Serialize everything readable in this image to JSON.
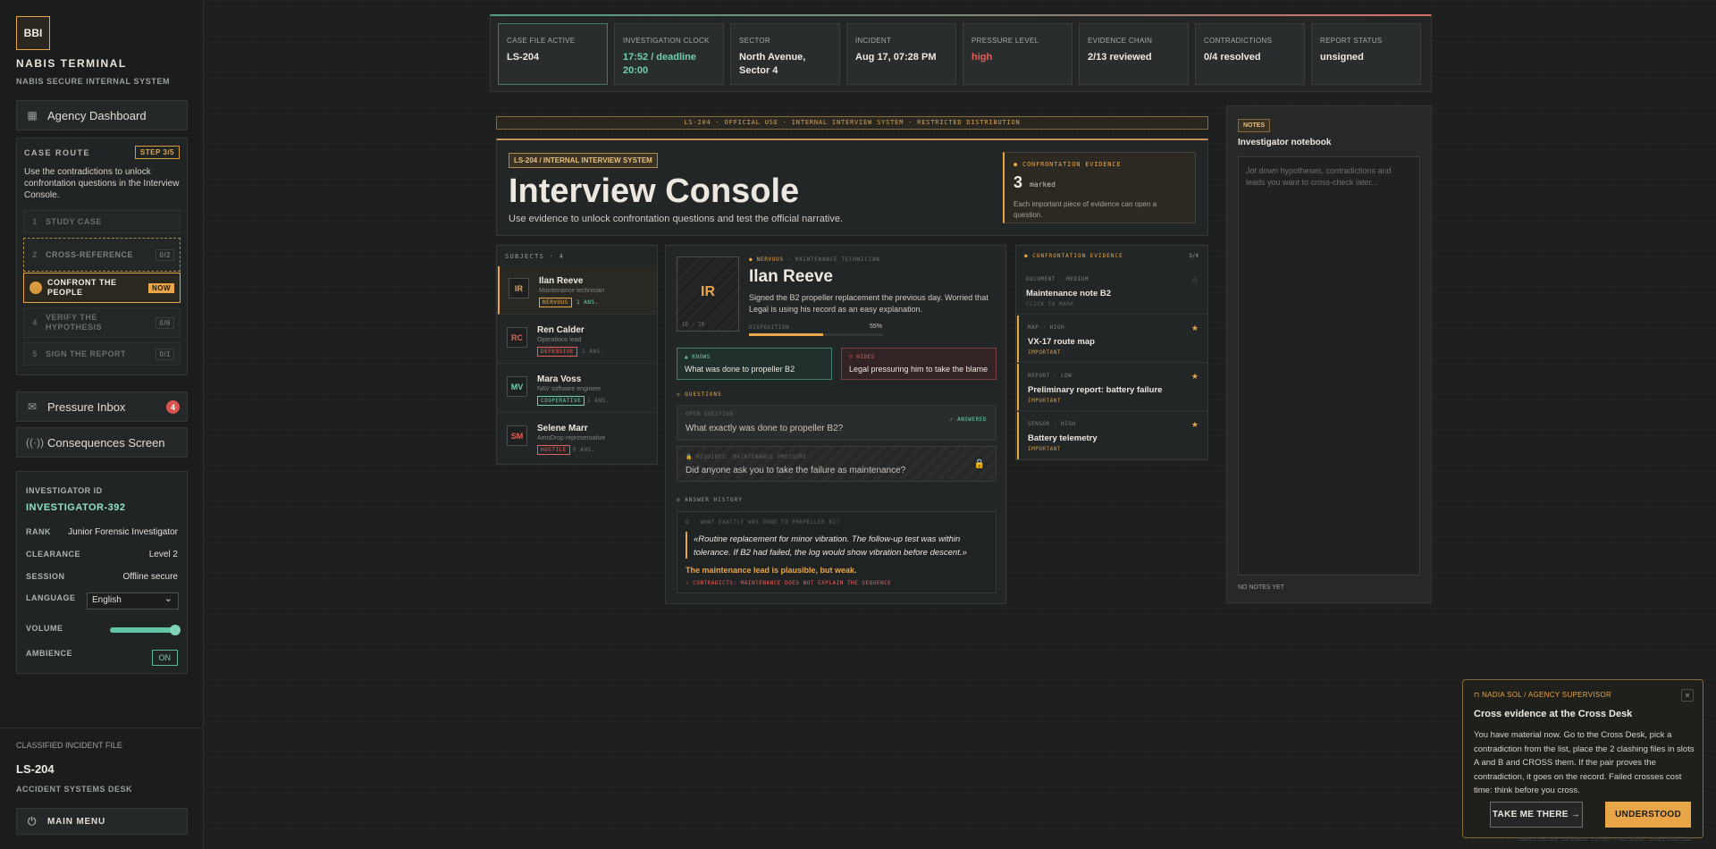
{
  "sidebar": {
    "logo": "BBI",
    "title": "NABIS TERMINAL",
    "subtitle": "NABIS SECURE INTERNAL SYSTEM",
    "nav": {
      "dashboard": "Agency Dashboard",
      "pressure_inbox": "Pressure Inbox",
      "pressure_badge": "4",
      "consequences": "Consequences Screen"
    },
    "route": {
      "heading": "CASE ROUTE",
      "step_tag": "STEP 3/5",
      "description": "Use the contradictions to unlock confrontation questions in the Interview Console.",
      "steps": [
        {
          "num": "1",
          "label": "STUDY CASE",
          "count": ""
        },
        {
          "num": "2",
          "label": "CROSS-REFERENCE",
          "count": "0/2"
        },
        {
          "num": "",
          "label": "CONFRONT THE PEOPLE",
          "count": "NOW"
        },
        {
          "num": "4",
          "label": "VERIFY THE HYPOTHESIS",
          "count": "0/6"
        },
        {
          "num": "5",
          "label": "SIGN THE REPORT",
          "count": "0/1"
        }
      ]
    },
    "investigator": {
      "id_label": "INVESTIGATOR ID",
      "id_value": "INVESTIGATOR-392",
      "rank_label": "RANK",
      "rank_value": "Junior Forensic Investigator",
      "clearance_label": "CLEARANCE",
      "clearance_value": "Level 2",
      "session_label": "SESSION",
      "session_value": "Offline secure",
      "language_label": "LANGUAGE",
      "language_value": "English",
      "volume_label": "VOLUME",
      "volume_level": 0.9,
      "ambience_label": "AMBIENCE",
      "ambience_value": "ON"
    },
    "footer": {
      "label": "CLASSIFIED INCIDENT FILE",
      "case": "LS-204",
      "desk": "ACCIDENT SYSTEMS DESK",
      "menu": "MAIN MENU"
    }
  },
  "topbar": [
    {
      "label": "CASE FILE ACTIVE",
      "value": "LS-204",
      "color": "#eee9e0"
    },
    {
      "label": "INVESTIGATION CLOCK",
      "value": "17:52 / deadline 20:00",
      "color": "#6fd0b0"
    },
    {
      "label": "SECTOR",
      "value": "North Avenue, Sector 4",
      "color": "#eee9e0"
    },
    {
      "label": "INCIDENT",
      "value": "Aug 17, 07:28 PM",
      "color": "#eee9e0"
    },
    {
      "label": "PRESSURE LEVEL",
      "value": "high",
      "color": "#e5605a"
    },
    {
      "label": "EVIDENCE CHAIN",
      "value": "2/13 reviewed",
      "color": "#eee9e0"
    },
    {
      "label": "CONTRADICTIONS",
      "value": "0/4 resolved",
      "color": "#eee9e0"
    },
    {
      "label": "REPORT STATUS",
      "value": "unsigned",
      "color": "#eee9e0"
    }
  ],
  "banner": "LS-204 · OFFICIAL USE · INTERNAL INTERVIEW SYSTEM · RESTRICTED DISTRIBUTION",
  "header": {
    "tag": "LS-204 / INTERNAL INTERVIEW SYSTEM",
    "title": "Interview Console",
    "subtitle": "Use evidence to unlock confrontation questions and test the official narrative.",
    "evidence_label": "CONFRONTATION EVIDENCE",
    "evidence_count": "3",
    "evidence_marked": "marked",
    "evidence_note": "Each important piece of evidence can open a question."
  },
  "subjects": {
    "heading": "SUBJECTS · 4",
    "items": [
      {
        "initials": "IR",
        "name": "Ilan Reeve",
        "role": "Maintenance technician",
        "tag": "NERVOUS",
        "ans": "1 ANS.",
        "color": "#e8a649",
        "ans_color": "#6fd0b0"
      },
      {
        "initials": "RC",
        "name": "Ren Calder",
        "role": "Operations lead",
        "tag": "DEFENSIVE",
        "ans": "1 ANS.",
        "color": "#e5605a",
        "ans_color": "#6d716e"
      },
      {
        "initials": "MV",
        "name": "Mara Voss",
        "role": "NAV software engineer",
        "tag": "COOPERATIVE",
        "ans": "1 ANS.",
        "color": "#6fd0b0",
        "ans_color": "#6d716e"
      },
      {
        "initials": "SM",
        "name": "Selene Marr",
        "role": "AeroDrop representative",
        "tag": "HOSTILE",
        "ans": "0 ANS.",
        "color": "#e5605a",
        "ans_color": "#6d716e"
      }
    ]
  },
  "profile": {
    "initials": "IR",
    "photo_code": "ID · IR",
    "status": "NERVOUS",
    "role": "MAINTENANCE TECHNICIAN",
    "name": "Ilan Reeve",
    "desc": "Signed the B2 propeller replacement the previous day. Worried that Legal is using his record as an easy explanation.",
    "disposition_label": "DISPOSITION",
    "disposition_value": "55%",
    "disposition_fraction": 0.55,
    "knows_label": "KNOWS",
    "knows_text": "What was done to propeller B2",
    "hides_label": "HIDES",
    "hides_text": "Legal pressuring him to take the blame",
    "questions_label": "QUESTIONS",
    "q1_cat": "OPEN QUESTION",
    "q1_status": "✓ ANSWERED",
    "q1_text": "What exactly was done to propeller B2?",
    "q2_cat": "REQUIRES: MAINTENANCE PRESSURE",
    "q2_text": "Did anyone ask you to take the failure as maintenance?",
    "history_label": "ANSWER HISTORY",
    "history_q": "Q · WHAT EXACTLY WAS DONE TO PROPELLER B2?",
    "history_answer": "«Routine replacement for minor vibration. The follow-up test was within tolerance. If B2 had failed, the log would show vibration before descent.»",
    "history_verdict": "The maintenance lead is plausible, but weak.",
    "history_contradicts": "⚠ CONTRADICTS: MAINTENANCE DOES NOT EXPLAIN THE SEQUENCE"
  },
  "evidence": {
    "heading": "CONFRONTATION EVIDENCE",
    "count": "3/4",
    "items": [
      {
        "cat": "DOCUMENT · MEDIUM",
        "title": "Maintenance note B2",
        "sub": "CLICK TO MARK",
        "marked": false
      },
      {
        "cat": "MAP · HIGH",
        "title": "VX-17 route map",
        "sub": "IMPORTANT",
        "marked": true
      },
      {
        "cat": "REPORT · LOW",
        "title": "Preliminary report: battery failure",
        "sub": "IMPORTANT",
        "marked": true
      },
      {
        "cat": "SENSOR · HIGH",
        "title": "Battery telemetry",
        "sub": "IMPORTANT",
        "marked": true
      }
    ]
  },
  "notes": {
    "tag": "NOTES",
    "title": "Investigator notebook",
    "placeholder": "Jot down hypotheses, contradictions and leads you want to cross-check later...",
    "footer": "NO NOTES YET"
  },
  "toast": {
    "from": "NADIA SOL / AGENCY SUPERVISOR",
    "title": "Cross evidence at the Cross Desk",
    "body": "You have material now. Go to the Cross Desk, pick a contradiction from the list, place the 2 clashing files in slots A and B and CROSS them. If the pair proves the contradiction, it goes on the record. Failed crosses cost time: think before you cross.",
    "take_me": "TAKE ME THERE",
    "understood": "UNDERSTOOD"
  },
  "watermark": "NABIS SECURE INTERNAL SYSTEM · ACCIDENT INVESTIGATION",
  "colors": {
    "accent": "#e8a649",
    "good": "#6fd0b0",
    "danger": "#e5605a"
  }
}
